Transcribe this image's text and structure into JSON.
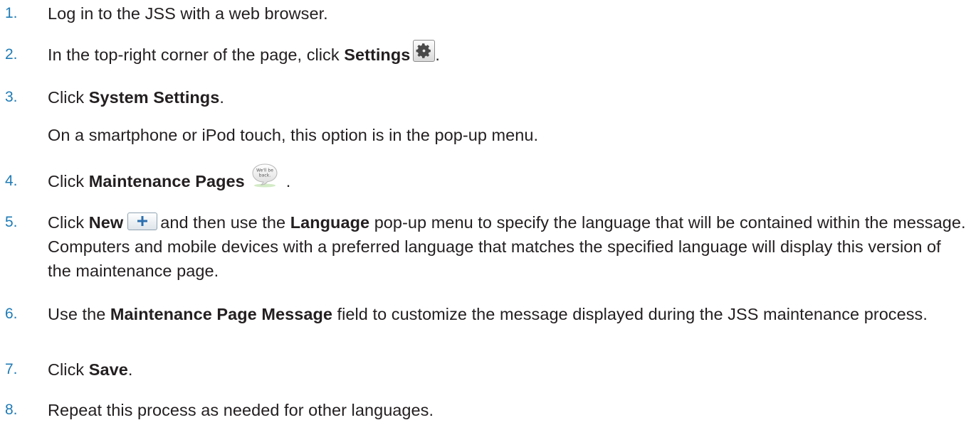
{
  "steps": [
    {
      "num": "1.",
      "pre": "Log in to the JSS with a web browser."
    },
    {
      "num": "2.",
      "pre": "In the top-right corner of the page, click ",
      "bold": "Settings",
      "post": "."
    },
    {
      "num": "3.",
      "pre": "Click ",
      "bold": "System Settings",
      "post": ".",
      "note": "On a smartphone or iPod touch, this option is in the pop-up menu."
    },
    {
      "num": "4.",
      "pre": "Click ",
      "bold": "Maintenance Pages",
      "post": "."
    },
    {
      "num": "5.",
      "pre": "Click ",
      "bold": "New",
      "mid": "and then use the ",
      "bold2": "Language",
      "post": " pop-up menu to specify the language that will be contained within the message. Computers and mobile devices with a preferred language that matches the specified language will display this version of the maintenance page."
    },
    {
      "num": "6.",
      "pre": "Use the ",
      "bold": "Maintenance Page Message",
      "post": " field to customize the message displayed during the JSS maintenance process."
    },
    {
      "num": "7.",
      "pre": "Click ",
      "bold": "Save",
      "post": "."
    },
    {
      "num": "8.",
      "pre": "Repeat this process as needed for other languages."
    }
  ],
  "icons": {
    "settings": "gear-icon",
    "maintenance": "speech-bubble-icon",
    "maintenance_text": "We'll be back.",
    "maintenance_lines": [
      "We'll be",
      "back."
    ],
    "new": "plus-icon"
  },
  "colors": {
    "step_number": "#1f7bb5",
    "text": "#231f20",
    "plus": "#2a6fb0"
  }
}
